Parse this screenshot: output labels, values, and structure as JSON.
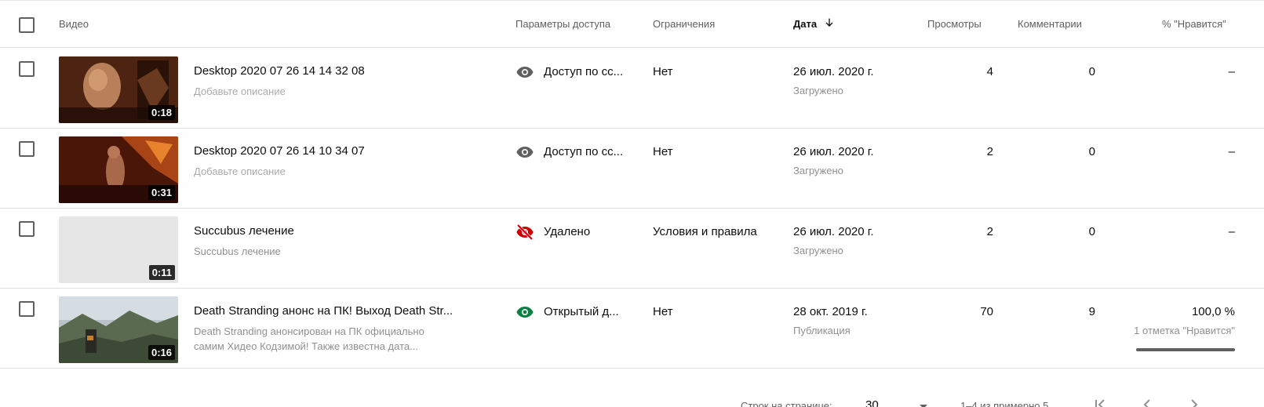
{
  "header": {
    "video": "Видео",
    "access": "Параметры доступа",
    "restrictions": "Ограничения",
    "date": "Дата",
    "views": "Просмотры",
    "comments": "Комментарии",
    "likes": "% \"Нравится\""
  },
  "rows": [
    {
      "duration": "0:18",
      "title": "Desktop 2020 07 26 14 14 32 08",
      "description": "Добавьте описание",
      "visibility_icon": "eye-icon",
      "visibility": "Доступ по сс...",
      "restrictions": "Нет",
      "date": "26 июл. 2020 г.",
      "date_status": "Загружено",
      "views": "4",
      "comments": "0",
      "likes": "–"
    },
    {
      "duration": "0:31",
      "title": "Desktop 2020 07 26 14 10 34 07",
      "description": "Добавьте описание",
      "visibility_icon": "eye-icon",
      "visibility": "Доступ по сс...",
      "restrictions": "Нет",
      "date": "26 июл. 2020 г.",
      "date_status": "Загружено",
      "views": "2",
      "comments": "0",
      "likes": "–"
    },
    {
      "duration": "0:11",
      "title": "Succubus лечение",
      "description": "Succubus лечение",
      "visibility_icon": "eye-off-icon",
      "visibility": "Удалено",
      "restrictions": "Условия и правила",
      "date": "26 июл. 2020 г.",
      "date_status": "Загружено",
      "views": "2",
      "comments": "0",
      "likes": "–"
    },
    {
      "duration": "0:16",
      "title": "Death Stranding анонс на ПК! Выход Death Str...",
      "description_line1": "Death Stranding анонсирован на ПК официально",
      "description_line2": "самим Хидео Кодзимой! Также известна дата...",
      "visibility_icon": "eye-icon",
      "visibility": "Открытый д...",
      "restrictions": "Нет",
      "date": "28 окт. 2019 г.",
      "date_status": "Публикация",
      "views": "70",
      "comments": "9",
      "likes": "100,0 %",
      "likes_count": "1 отметка \"Нравится\"",
      "likes_fraction": 1.0
    }
  ],
  "footer": {
    "rows_label": "Строк на странице:",
    "rows_value": "30",
    "range": "1–4 из примерно 5"
  },
  "colors": {
    "icon_gray": "#606060",
    "removed_red": "#cc0000",
    "public_green": "#0b8043"
  }
}
